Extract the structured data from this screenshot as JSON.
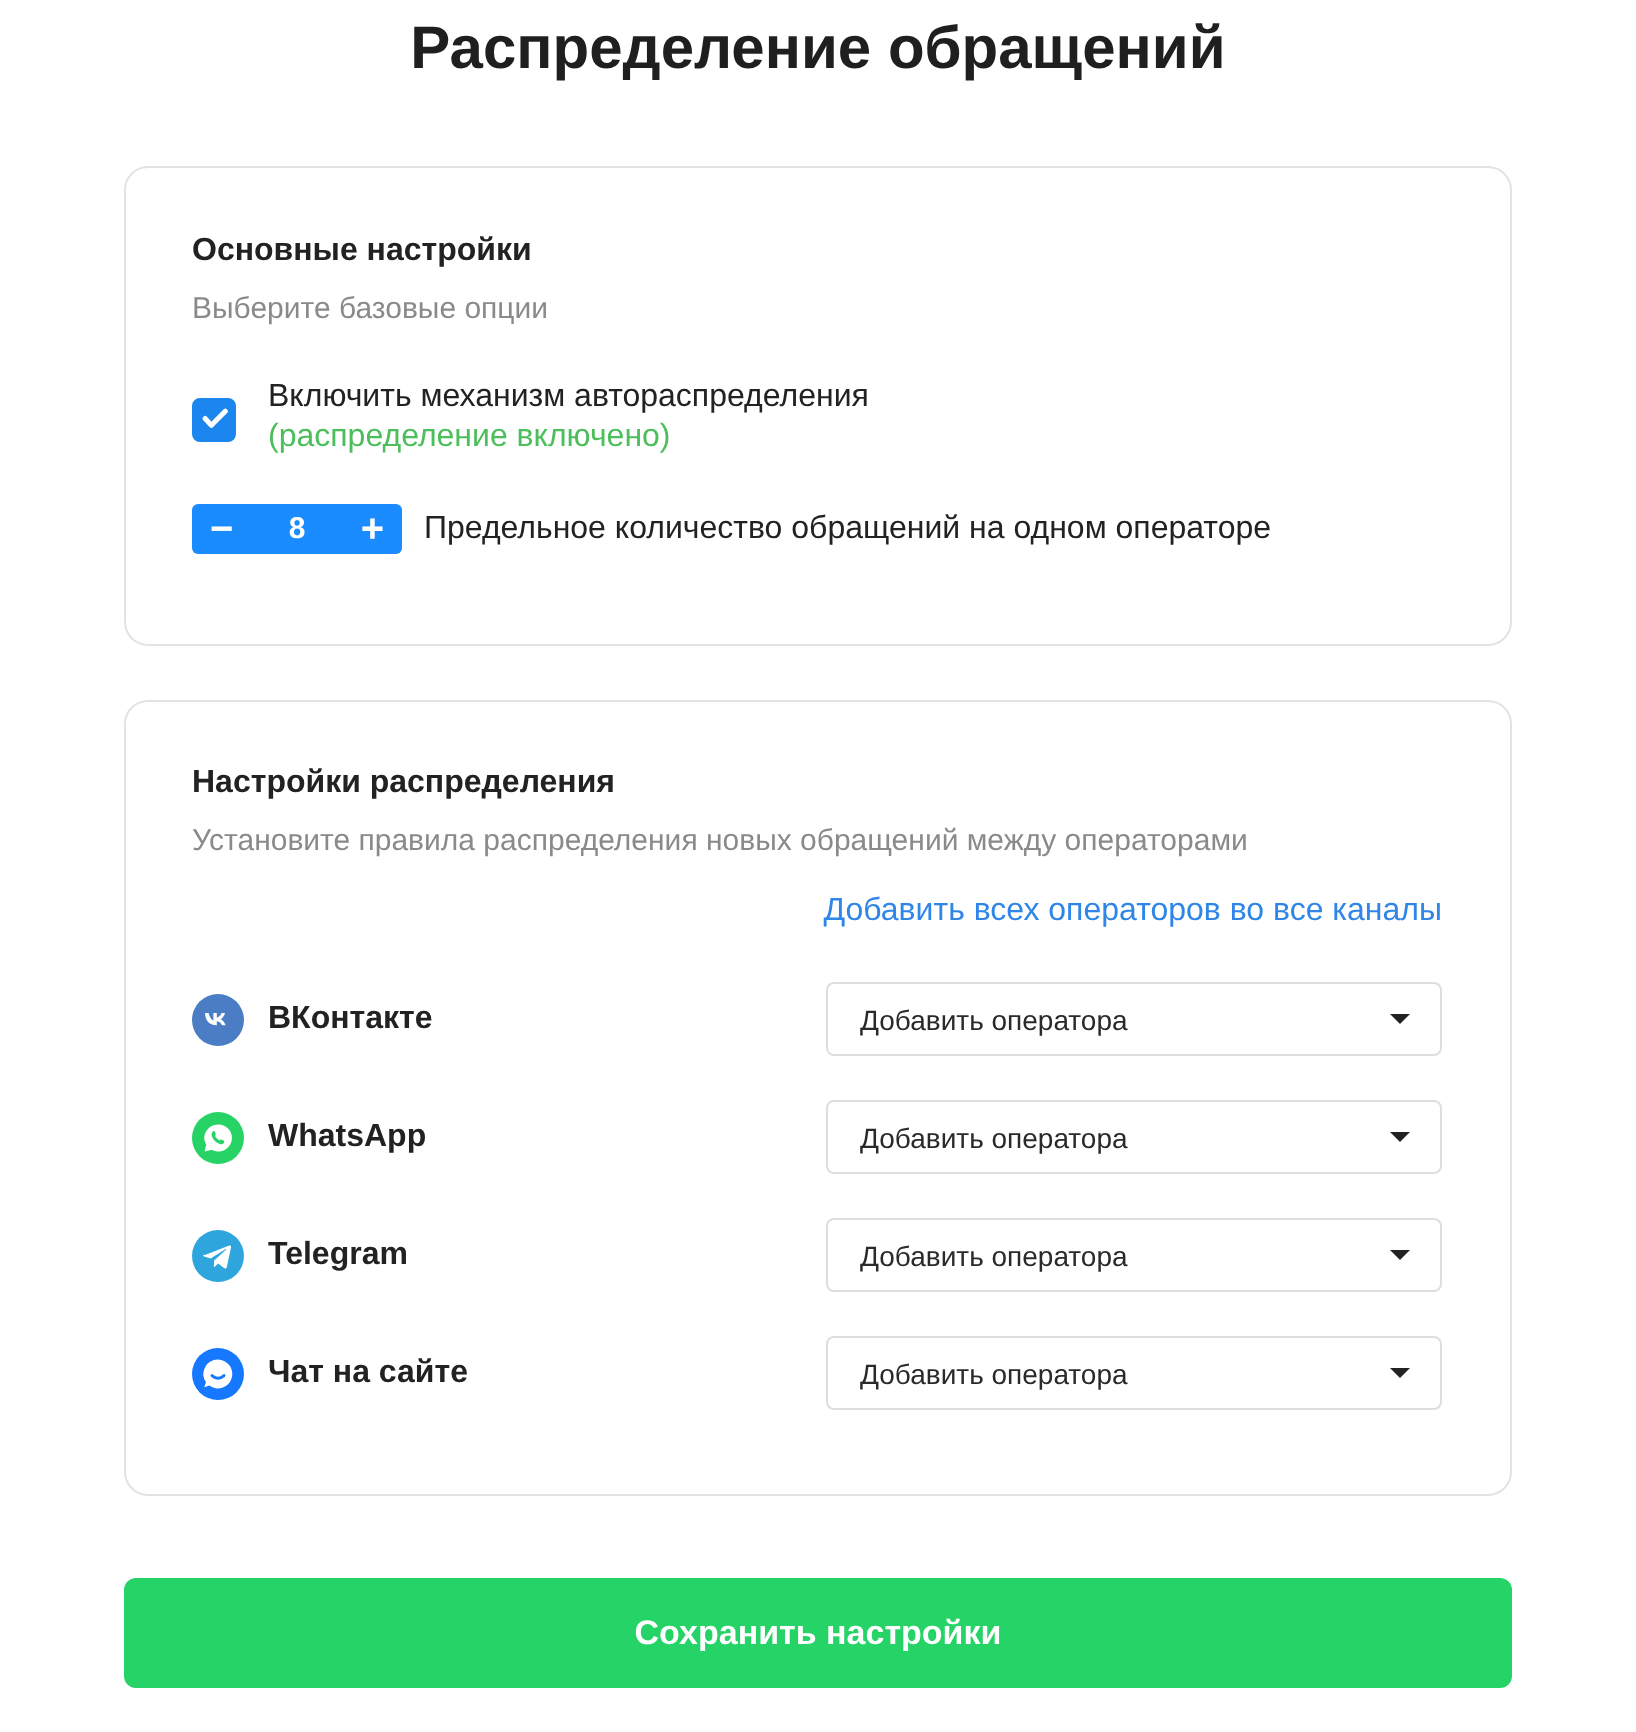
{
  "title": "Распределение обращений",
  "basic": {
    "title": "Основные настройки",
    "subtitle": "Выберите базовые опции",
    "auto": {
      "label": "Включить механизм автораспределения",
      "status": "(распределение включено)",
      "checked": true
    },
    "limit": {
      "minus": "−",
      "value": "8",
      "plus": "+",
      "label": "Предельное количество обращений на одном операторе"
    }
  },
  "distribution": {
    "title": "Настройки распределения",
    "subtitle": "Установите правила распределения новых обращений между операторами",
    "add_all_link": "Добавить всех операторов во все каналы",
    "channels": [
      {
        "name": "ВКонтакте",
        "kind": "vk",
        "color": "#4a7dc4",
        "select": {
          "placeholder": "Добавить оператора"
        }
      },
      {
        "name": "WhatsApp",
        "kind": "whatsapp",
        "color": "#28d366",
        "select": {
          "placeholder": "Добавить оператора"
        }
      },
      {
        "name": "Telegram",
        "kind": "telegram",
        "color": "#2ea6dd",
        "select": {
          "placeholder": "Добавить оператора"
        }
      },
      {
        "name": "Чат на сайте",
        "kind": "webchat",
        "color": "#1677ff",
        "select": {
          "placeholder": "Добавить оператора"
        }
      }
    ]
  },
  "save_button": "Сохранить настройки"
}
